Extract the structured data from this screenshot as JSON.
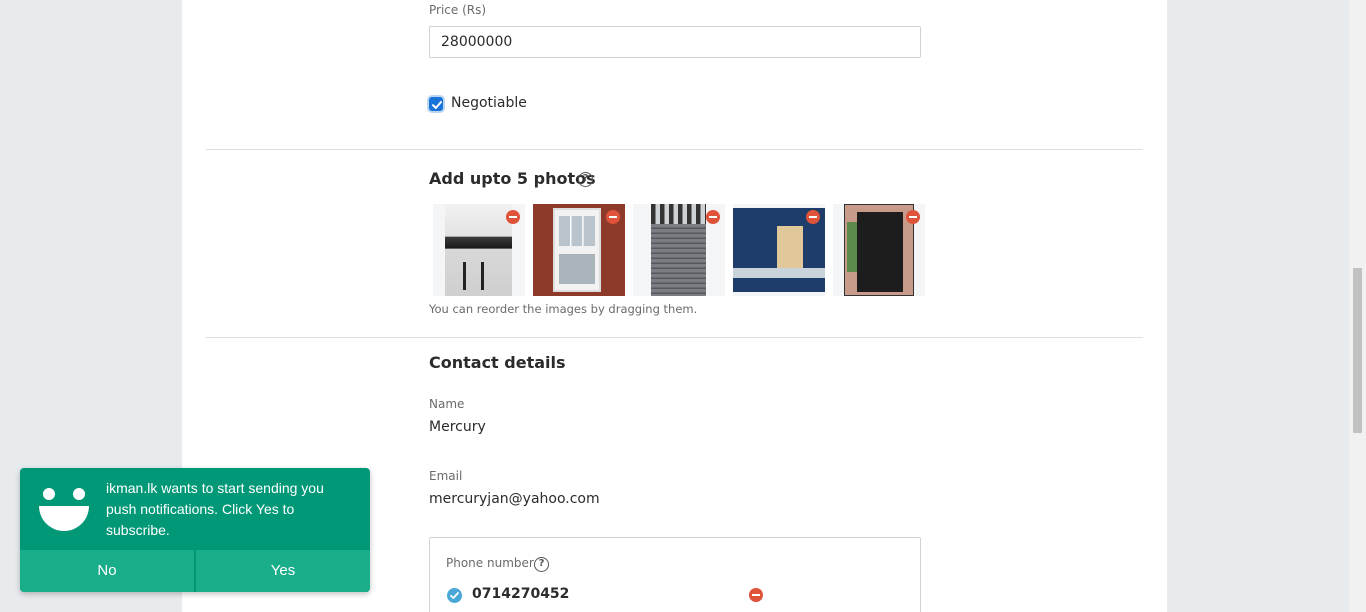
{
  "form": {
    "price": {
      "label": "Price (Rs)",
      "value": "28000000"
    },
    "negotiable": {
      "label": "Negotiable",
      "checked": true
    }
  },
  "photos": {
    "title": "Add upto 5 photos",
    "hint": "You can reorder the images by dragging them.",
    "items": [
      {
        "name": "photo-wall-bar-table",
        "colors": [
          "#e8e8e8",
          "#2a2a2a"
        ]
      },
      {
        "name": "photo-white-window",
        "colors": [
          "#8e3a2b",
          "#f2f2f2"
        ]
      },
      {
        "name": "photo-roller-shutter",
        "colors": [
          "#6b6f74",
          "#3a3d40"
        ]
      },
      {
        "name": "photo-blue-kitchen",
        "colors": [
          "#1f3d6b",
          "#e0c89a"
        ]
      },
      {
        "name": "photo-black-door",
        "colors": [
          "#1d1d1d",
          "#c79a8a"
        ]
      }
    ]
  },
  "contact": {
    "title": "Contact details",
    "name_label": "Name",
    "name_value": "Mercury",
    "email_label": "Email",
    "email_value": "mercuryjan@yahoo.com",
    "phone_label": "Phone number",
    "phone_value": "0714270452"
  },
  "notification": {
    "message": "ikman.lk wants to start sending you push notifications. Click Yes to subscribe.",
    "no_label": "No",
    "yes_label": "Yes"
  },
  "colors": {
    "accent_blue": "#1a73d9",
    "remove_red": "#e0533b",
    "notify_green": "#009877"
  }
}
